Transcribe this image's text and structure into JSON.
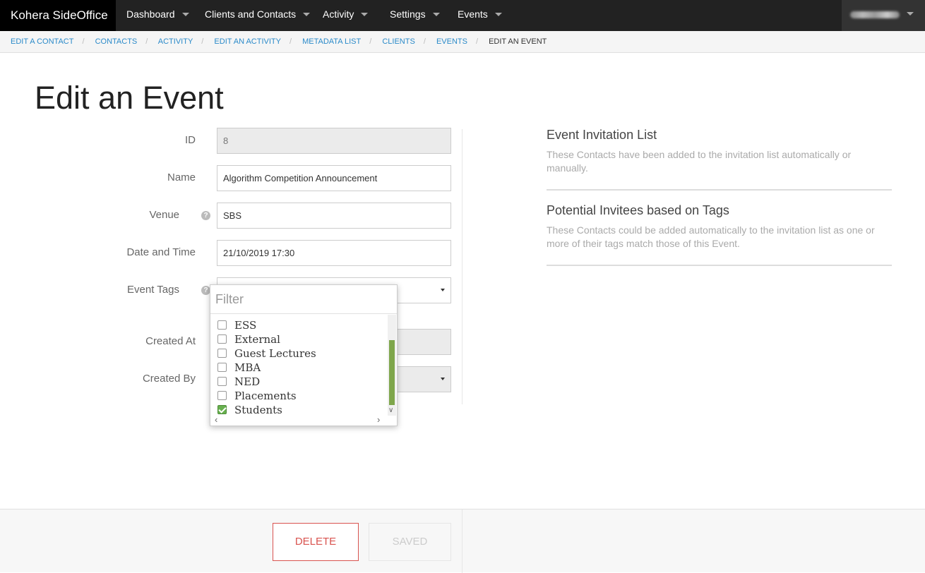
{
  "app": {
    "brand": "Kohera SideOffice",
    "nav": [
      {
        "label": "Dashboard"
      },
      {
        "label": "Clients and Contacts"
      },
      {
        "label": "Activity"
      },
      {
        "label": "Settings"
      },
      {
        "label": "Events"
      }
    ]
  },
  "breadcrumb": [
    {
      "label": "EDIT A CONTACT"
    },
    {
      "label": "CONTACTS"
    },
    {
      "label": "ACTIVITY"
    },
    {
      "label": "EDIT AN ACTIVITY"
    },
    {
      "label": "METADATA LIST"
    },
    {
      "label": "CLIENTS"
    },
    {
      "label": "EVENTS"
    },
    {
      "label": "EDIT AN EVENT"
    }
  ],
  "page": {
    "title": "Edit an Event"
  },
  "form": {
    "id": {
      "label": "ID",
      "value": "8"
    },
    "name": {
      "label": "Name",
      "value": "Algorithm Competition Announcement"
    },
    "venue": {
      "label": "Venue",
      "value": "SBS"
    },
    "datetime": {
      "label": "Date and Time",
      "value": "21/10/2019 17:30"
    },
    "tags": {
      "label": "Event Tags"
    },
    "created_at": {
      "label": "Created At"
    },
    "created_by": {
      "label": "Created By"
    }
  },
  "dropdown": {
    "placeholder": "Filter",
    "options": [
      {
        "label": "ESS",
        "checked": false
      },
      {
        "label": "External",
        "checked": false
      },
      {
        "label": "Guest Lectures",
        "checked": false
      },
      {
        "label": "MBA",
        "checked": false
      },
      {
        "label": "NED",
        "checked": false
      },
      {
        "label": "Placements",
        "checked": false
      },
      {
        "label": "Students",
        "checked": true
      }
    ]
  },
  "panel": {
    "invitation": {
      "title": "Event Invitation List",
      "desc": "These Contacts have been added to the invitation list automatically or manually."
    },
    "potential": {
      "title": "Potential Invitees based on Tags",
      "desc": "These Contacts could be added automatically to the invitation list as one or more of their tags match those of this Event."
    }
  },
  "footer": {
    "delete_label": "DELETE",
    "saved_label": "SAVED"
  },
  "icons": {
    "help": "help-circle-icon",
    "caret": "caret-down-icon",
    "check": "check-icon"
  },
  "colors": {
    "accent_link": "#2a8ac9",
    "danger": "#d9534f",
    "check_green": "#68b04f",
    "nav_bg": "#222222"
  }
}
